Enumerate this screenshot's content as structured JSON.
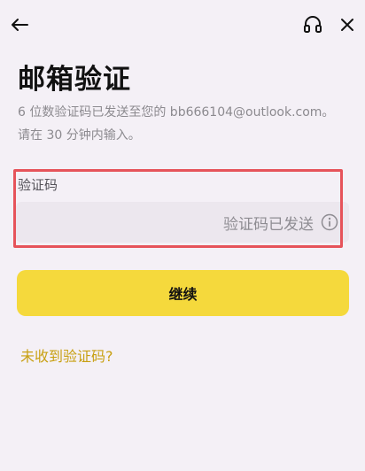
{
  "page": {
    "title": "邮箱验证",
    "description_line1": "6 位数验证码已发送至您的 bb666104@outlook.com。",
    "description_line2": "请在 30 分钟内输入。"
  },
  "form": {
    "code_label": "验证码",
    "code_status": "验证码已发送"
  },
  "actions": {
    "continue_label": "继续",
    "resend_label": "未收到验证码?"
  },
  "colors": {
    "accent": "#f5d93c",
    "link": "#c8a012",
    "highlight": "#e6535a",
    "background": "#f4f0f6"
  },
  "icons": {
    "back": "arrow-left-icon",
    "support": "headset-icon",
    "close": "close-icon",
    "info": "info-icon"
  }
}
